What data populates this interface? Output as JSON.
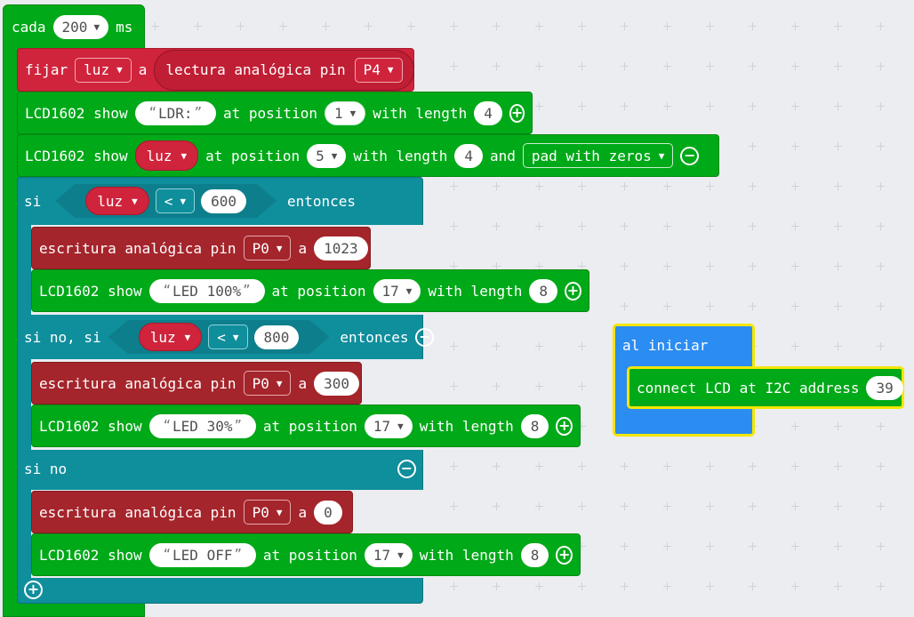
{
  "every": {
    "label_cada": "cada",
    "interval": "200",
    "unit": "ms"
  },
  "set": {
    "fijar": "fijar",
    "var": "luz",
    "a": "a",
    "reading_label": "lectura analógica pin",
    "pin": "P4"
  },
  "lcd1": {
    "show": "LCD1602 show",
    "text": "LDR:",
    "at": "at position",
    "pos": "1",
    "wl": "with length",
    "len": "4"
  },
  "lcd2": {
    "show": "LCD1602 show",
    "var": "luz",
    "at": "at position",
    "pos": "5",
    "wl": "with length",
    "len": "4",
    "and": "and",
    "pad": "pad with zeros"
  },
  "if": {
    "si": "si",
    "var": "luz",
    "op": "<",
    "value": "600",
    "then": "entonces"
  },
  "write1": {
    "label": "escritura analógica pin",
    "pin": "P0",
    "a": "a",
    "value": "1023"
  },
  "lcd3": {
    "show": "LCD1602 show",
    "text": "LED 100%",
    "at": "at position",
    "pos": "17",
    "wl": "with length",
    "len": "8"
  },
  "elseif": {
    "label": "si no, si",
    "var": "luz",
    "op": "<",
    "value": "800",
    "then": "entonces"
  },
  "write2": {
    "label": "escritura analógica pin",
    "pin": "P0",
    "a": "a",
    "value": "300"
  },
  "lcd4": {
    "show": "LCD1602 show",
    "text": "LED 30%",
    "at": "at position",
    "pos": "17",
    "wl": "with length",
    "len": "8"
  },
  "else": {
    "label": "si no"
  },
  "write3": {
    "label": "escritura analógica pin",
    "pin": "P0",
    "a": "a",
    "value": "0"
  },
  "lcd5": {
    "show": "LCD1602 show",
    "text": "LED OFF",
    "at": "at position",
    "pos": "17",
    "wl": "with length",
    "len": "8"
  },
  "start": {
    "label": "al iniciar",
    "connect": "connect LCD at I2C address",
    "address": "39"
  },
  "icons": {
    "plus": "+",
    "minus": "−",
    "caret": "▼"
  }
}
